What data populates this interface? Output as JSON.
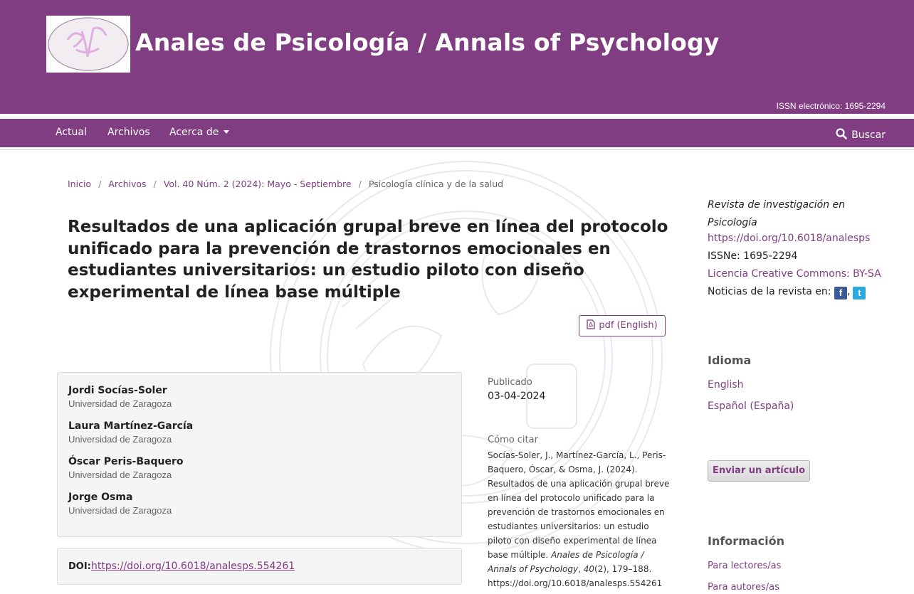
{
  "header": {
    "site_title": "Anales de Psicología / Annals of Psychology",
    "issn": "ISSN electrónico: 1695-2294",
    "brand_color": "#813d82"
  },
  "nav": {
    "items": [
      "Actual",
      "Archivos",
      "Acerca de"
    ],
    "search": "Buscar"
  },
  "breadcrumb": [
    "Inicio",
    "Archivos",
    "Vol. 40 Núm. 2 (2024): Mayo - Septiembre",
    "Psicología clínica y de la salud"
  ],
  "article": {
    "title": "Resultados de una aplicación grupal breve en línea del protocolo unificado para la prevención de trastornos emocionales en estudiantes universitarios: un estudio piloto con diseño experimental de línea base múltiple",
    "pdf_label": "pdf (English)",
    "authors": [
      {
        "name": "Jordi Socías-Soler",
        "affiliation": "Universidad de Zaragoza"
      },
      {
        "name": "Laura Martínez-García",
        "affiliation": "Universidad de Zaragoza"
      },
      {
        "name": "Óscar Peris-Baquero",
        "affiliation": "Universidad de Zaragoza"
      },
      {
        "name": "Jorge Osma",
        "affiliation": "Universidad de Zaragoza"
      }
    ],
    "doi_label": "DOI:",
    "doi": "https://doi.org/10.6018/analesps.554261",
    "published_label": "Publicado",
    "published_date": "03-04-2024",
    "cite_label": "Cómo citar",
    "cite_text_1": "Socías-Soler, J., Martínez-García, L., Peris-Baquero, Óscar, & Osma, J. (2024). Resultados de una aplicación grupal breve en línea del protocolo unificado para la prevención de trastornos emocionales en estudiantes universitarios: un estudio piloto con diseño experimental de línea base múltiple. ",
    "cite_journal": "Anales de Psicología / Annals of Psychology",
    "cite_sep": ", ",
    "cite_volume": "40",
    "cite_text_2": "(2), 179–188. https://doi.org/10.6018/analesps.554261"
  },
  "sidebar": {
    "description": "Revista de investigación en Psicología",
    "doi_link": "https://doi.org/10.6018/analesps",
    "issn": "ISSNe: 1695-2294",
    "license": "Licencia Creative Commons: BY-SA",
    "news_label": "Noticias de la revista en:",
    "news_sep": ",",
    "language_heading": "Idioma",
    "languages": [
      "English",
      "Español (España)"
    ],
    "submit_button": "Enviar un artículo",
    "info_heading": "Información",
    "info_links": [
      "Para lectores/as",
      "Para autores/as"
    ]
  }
}
